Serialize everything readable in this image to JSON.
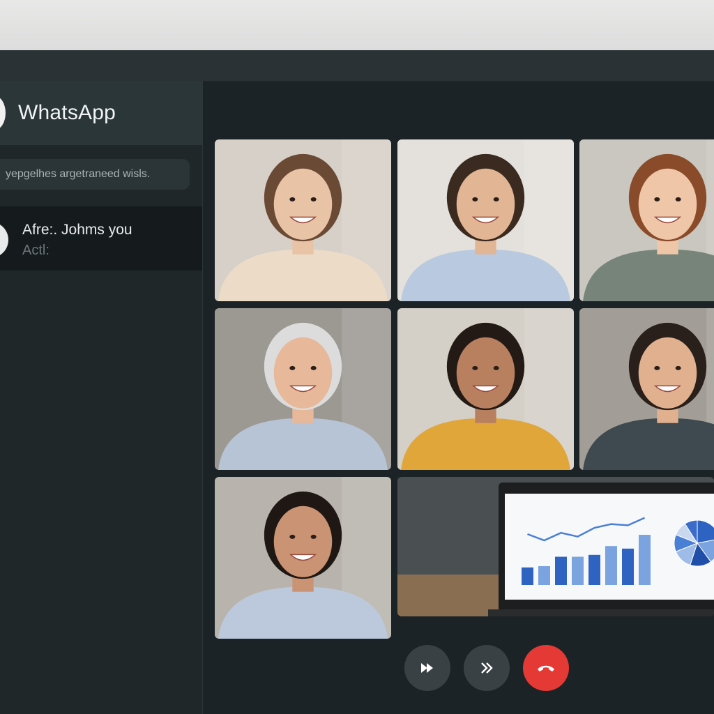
{
  "app": {
    "title": "WhatsApp"
  },
  "sidebar": {
    "search_text": "yepgelhes argetraneed wisls.",
    "chats": [
      {
        "name": "Afre:. Johms you",
        "preview": "Actl:"
      }
    ]
  },
  "call": {
    "participants": [
      {
        "id": "participant-1",
        "hair": "#6b4a35",
        "skin": "#e9c3a6",
        "shirt": "#ecdcc7",
        "bg": "#d6d0c8"
      },
      {
        "id": "participant-2",
        "hair": "#3b2a20",
        "skin": "#e2b594",
        "shirt": "#b9c9df",
        "bg": "#e4e1dc"
      },
      {
        "id": "participant-3",
        "hair": "#8a4b2a",
        "skin": "#efc6a8",
        "shirt": "#76847a",
        "bg": "#c9c7bf"
      },
      {
        "id": "participant-4",
        "hair": "#dcdcdc",
        "skin": "#e7b899",
        "shirt": "#b7c4d6",
        "bg": "#9c9892"
      },
      {
        "id": "participant-5",
        "hair": "#231a16",
        "skin": "#b98060",
        "shirt": "#e0a63a",
        "bg": "#d4cfc7"
      },
      {
        "id": "participant-6",
        "hair": "#2a201b",
        "skin": "#e1b08e",
        "shirt": "#3e4a4f",
        "bg": "#a29e97"
      },
      {
        "id": "participant-7",
        "hair": "#1f1714",
        "skin": "#c99374",
        "shirt": "#bcc9dc",
        "bg": "#b8b4ad"
      }
    ],
    "screen_share": {
      "bar_values": [
        28,
        30,
        45,
        45,
        48,
        62,
        58,
        80
      ],
      "line_values": [
        70,
        60,
        72,
        66,
        80,
        86,
        84,
        96
      ],
      "pie_slices": [
        22,
        18,
        15,
        14,
        12,
        10,
        9
      ],
      "colors": {
        "bar_dark": "#2f63c2",
        "bar_light": "#7aa3e0",
        "line": "#4a7fd6"
      }
    },
    "controls": [
      {
        "id": "fast-forward-button",
        "icon": "fast-forward-icon"
      },
      {
        "id": "skip-button",
        "icon": "skip-forward-icon"
      },
      {
        "id": "end-call-button",
        "icon": "end-call-icon"
      }
    ],
    "colors": {
      "end_call": "#e53935",
      "control_bg": "#3a4144"
    }
  }
}
